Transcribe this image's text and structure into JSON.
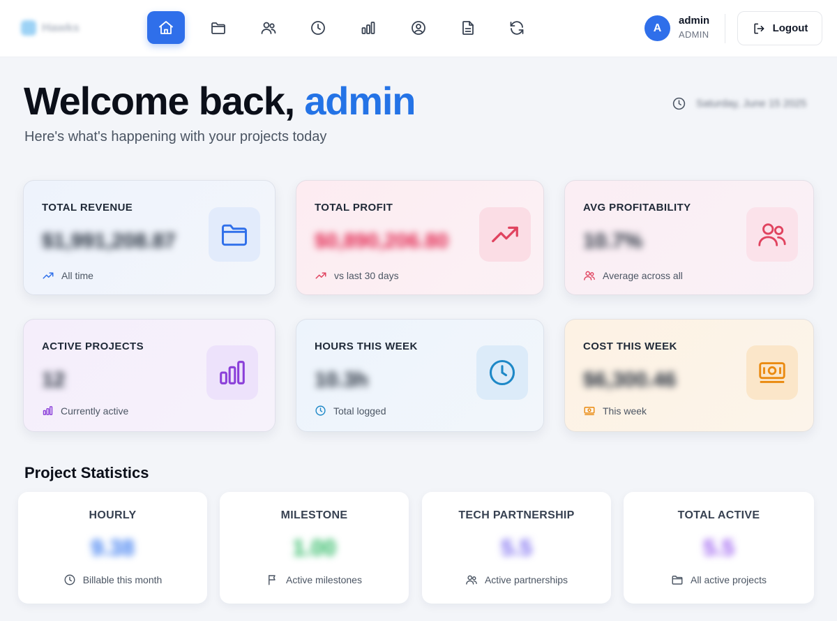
{
  "brand": {
    "name": "Hawks"
  },
  "nav": {
    "items": [
      {
        "icon": "home-icon",
        "active": true
      },
      {
        "icon": "folder-icon",
        "active": false
      },
      {
        "icon": "users-icon",
        "active": false
      },
      {
        "icon": "clock-icon",
        "active": false
      },
      {
        "icon": "bar-chart-icon",
        "active": false
      },
      {
        "icon": "user-circle-icon",
        "active": false
      },
      {
        "icon": "document-icon",
        "active": false
      },
      {
        "icon": "refresh-icon",
        "active": false
      }
    ]
  },
  "user": {
    "initial": "A",
    "name": "admin",
    "role": "ADMIN"
  },
  "logout_label": "Logout",
  "welcome": {
    "prefix": "Welcome back, ",
    "name": "admin",
    "subtitle": "Here's what's happening with your projects today",
    "date": "Saturday, June 15 2025"
  },
  "cards": [
    {
      "label": "TOTAL REVENUE",
      "value": "$1,991,208.87",
      "footnote": "All time",
      "icon": "folder-icon",
      "value_color": "#1f2937",
      "accent": "#2f6fea"
    },
    {
      "label": "TOTAL PROFIT",
      "value": "$0,890,206.80",
      "footnote": "vs last 30 days",
      "icon": "trending-up-icon",
      "value_color": "#e11d48",
      "accent": "#e0435f"
    },
    {
      "label": "AVG PROFITABILITY",
      "value": "10.7%",
      "footnote": "Average across all",
      "icon": "users-icon",
      "value_color": "#1f2937",
      "accent": "#e0435f"
    },
    {
      "label": "ACTIVE PROJECTS",
      "value": "12",
      "footnote": "Currently active",
      "icon": "bar-chart-icon",
      "value_color": "#1f2937",
      "accent": "#8b3fd9"
    },
    {
      "label": "HOURS THIS WEEK",
      "value": "10.3h",
      "footnote": "Total logged",
      "icon": "clock-icon",
      "value_color": "#1f2937",
      "accent": "#1e88c7"
    },
    {
      "label": "COST THIS WEEK",
      "value": "$6,300.46",
      "footnote": "This week",
      "icon": "banknote-icon",
      "value_color": "#1f2937",
      "accent": "#ea8a10"
    }
  ],
  "statistics": {
    "title": "Project Statistics",
    "tiles": [
      {
        "title": "HOURLY",
        "value": "9.38",
        "footnote": "Billable this month",
        "icon": "clock-icon",
        "value_color": "#3b7bf0"
      },
      {
        "title": "MILESTONE",
        "value": "1.00",
        "footnote": "Active milestones",
        "icon": "flag-icon",
        "value_color": "#22b55b"
      },
      {
        "title": "TECH PARTNERSHIP",
        "value": "5.5",
        "footnote": "Active partnerships",
        "icon": "users-icon",
        "value_color": "#7c6cf0"
      },
      {
        "title": "TOTAL ACTIVE",
        "value": "5.5",
        "footnote": "All active projects",
        "icon": "folder-icon",
        "value_color": "#9a5cf0"
      }
    ]
  }
}
